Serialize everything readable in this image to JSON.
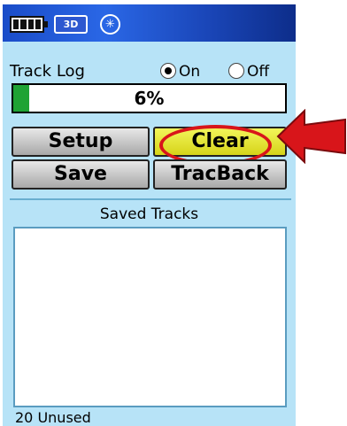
{
  "status_bar": {
    "gps_mode": "3D",
    "icons": [
      "battery-icon",
      "3d-fix-icon",
      "compass-icon"
    ]
  },
  "track_log": {
    "label": "Track Log",
    "options": [
      {
        "label": "On",
        "selected": true
      },
      {
        "label": "Off",
        "selected": false
      }
    ],
    "progress_percent": 6,
    "progress_text": "6%"
  },
  "buttons": {
    "setup": "Setup",
    "clear": "Clear",
    "save": "Save",
    "tracback": "TracBack"
  },
  "saved_tracks": {
    "title": "Saved Tracks",
    "items": [],
    "footer": "20 Unused"
  },
  "colors": {
    "background": "#b7e3f7",
    "status_bar": "#2a67e6",
    "progress_fill": "#1fa334",
    "highlight_button": "#f2f55a",
    "annotation_red": "#d8151a"
  }
}
